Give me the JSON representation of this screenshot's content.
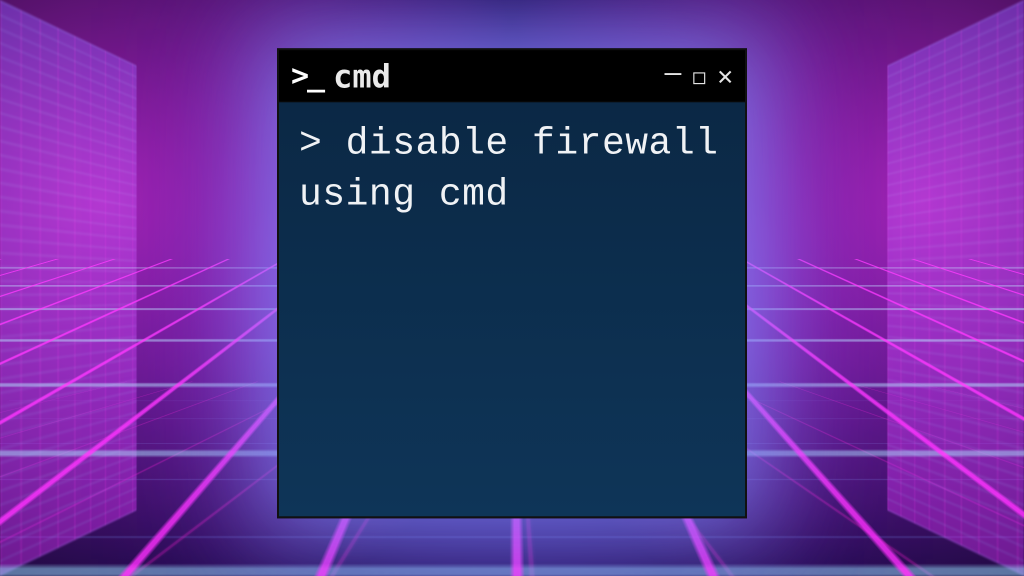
{
  "window": {
    "icon_label": ">_",
    "title": "cmd",
    "controls": {
      "minimize": "–",
      "maximize": "□",
      "close": "✕"
    }
  },
  "terminal": {
    "prompt": ">",
    "command": "disable firewall using cmd"
  },
  "colors": {
    "titlebar_bg": "#000000",
    "body_bg": "#0e3558",
    "text": "#f0f2f5",
    "neon_pink": "#ff28e6",
    "neon_blue": "#4a6aff"
  }
}
